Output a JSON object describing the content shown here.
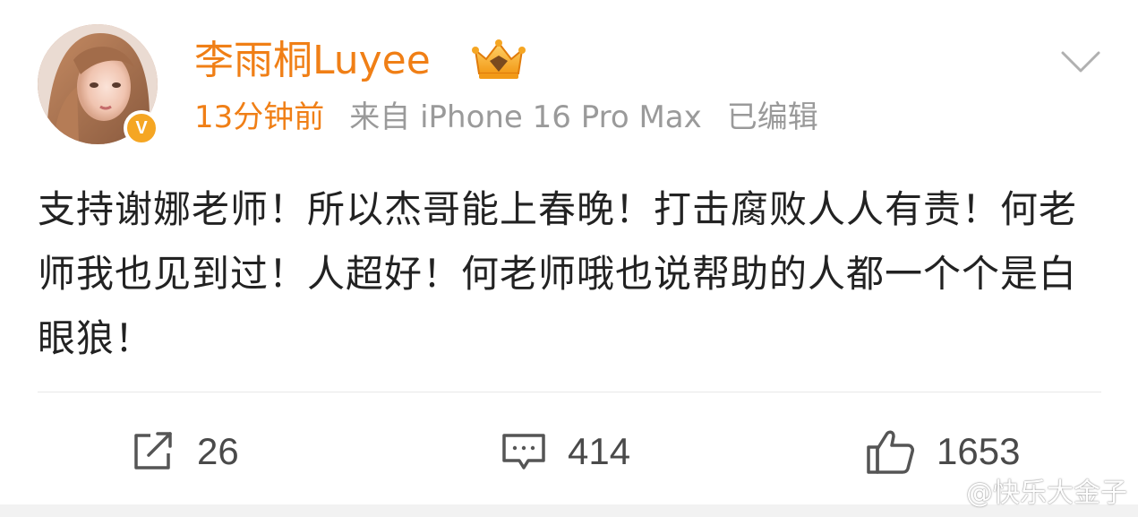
{
  "post": {
    "author": {
      "name": "李雨桐Luyee",
      "verified_badge": "V",
      "crown_icon": "crown-icon"
    },
    "meta": {
      "time": "13分钟前",
      "source": "来自 iPhone 16 Pro Max",
      "edited": "已编辑"
    },
    "text": "支持谢娜老师！所以杰哥能上春晚！打击腐败人人有责！何老师我也见到过！人超好！何老师哦也说帮助的人都一个个是白眼狼！",
    "actions": {
      "repost_count": "26",
      "comment_count": "414",
      "like_count": "1653"
    }
  },
  "watermark": {
    "text": "@快乐大金子"
  },
  "colors": {
    "accent_orange": "#f07f16",
    "meta_gray": "#9a9a9a",
    "text_dark": "#222222",
    "badge_orange": "#f5a623"
  }
}
